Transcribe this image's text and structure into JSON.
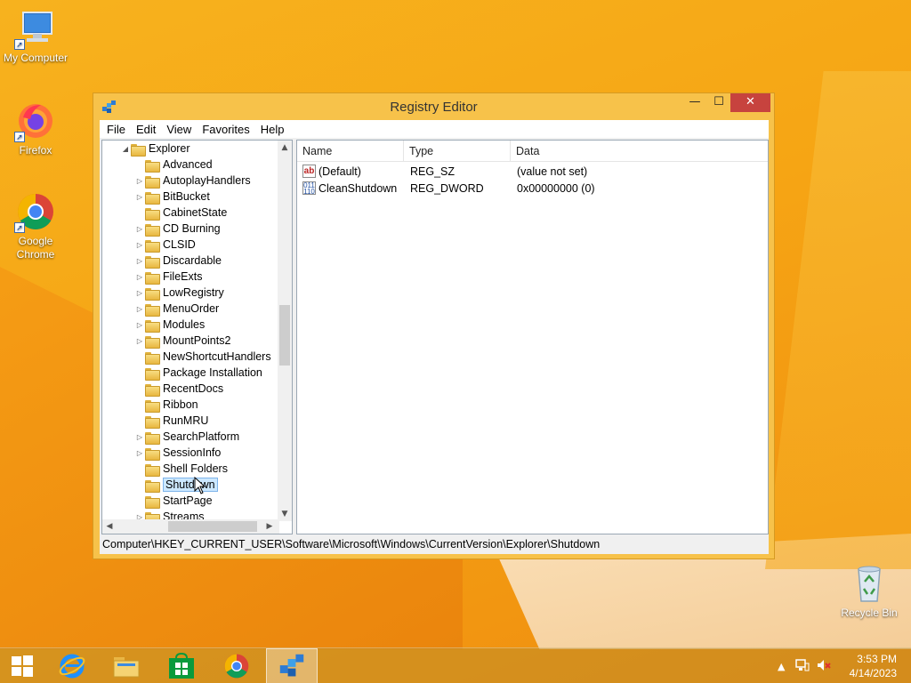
{
  "desktop": {
    "icons": [
      {
        "label": "My Computer"
      },
      {
        "label": "Firefox"
      },
      {
        "label": "Google Chrome"
      },
      {
        "label": "Recycle Bin"
      }
    ]
  },
  "window": {
    "title": "Registry Editor",
    "menu": [
      "File",
      "Edit",
      "View",
      "Favorites",
      "Help"
    ],
    "tree": {
      "parent": "Explorer",
      "items": [
        {
          "label": "Advanced",
          "expandable": false
        },
        {
          "label": "AutoplayHandlers",
          "expandable": true
        },
        {
          "label": "BitBucket",
          "expandable": true
        },
        {
          "label": "CabinetState",
          "expandable": false
        },
        {
          "label": "CD Burning",
          "expandable": true
        },
        {
          "label": "CLSID",
          "expandable": true
        },
        {
          "label": "Discardable",
          "expandable": true
        },
        {
          "label": "FileExts",
          "expandable": true
        },
        {
          "label": "LowRegistry",
          "expandable": true
        },
        {
          "label": "MenuOrder",
          "expandable": true
        },
        {
          "label": "Modules",
          "expandable": true
        },
        {
          "label": "MountPoints2",
          "expandable": true
        },
        {
          "label": "NewShortcutHandlers",
          "expandable": false
        },
        {
          "label": "Package Installation",
          "expandable": false
        },
        {
          "label": "RecentDocs",
          "expandable": false
        },
        {
          "label": "Ribbon",
          "expandable": false
        },
        {
          "label": "RunMRU",
          "expandable": false
        },
        {
          "label": "SearchPlatform",
          "expandable": true
        },
        {
          "label": "SessionInfo",
          "expandable": true
        },
        {
          "label": "Shell Folders",
          "expandable": false
        },
        {
          "label": "Shutdown",
          "expandable": false,
          "selected": true
        },
        {
          "label": "StartPage",
          "expandable": false
        },
        {
          "label": "Streams",
          "expandable": true
        }
      ]
    },
    "columns": [
      "Name",
      "Type",
      "Data"
    ],
    "values": [
      {
        "icon": "string-value-icon",
        "name": "(Default)",
        "type": "REG_SZ",
        "data": "(value not set)"
      },
      {
        "icon": "binary-value-icon",
        "name": "CleanShutdown",
        "type": "REG_DWORD",
        "data": "0x00000000 (0)"
      }
    ],
    "status_path": "Computer\\HKEY_CURRENT_USER\\Software\\Microsoft\\Windows\\CurrentVersion\\Explorer\\Shutdown"
  },
  "taskbar": {
    "apps": [
      "start-icon",
      "internet-explorer-icon",
      "file-explorer-icon",
      "store-icon",
      "chrome-icon",
      "regedit-icon"
    ],
    "active_app": "regedit-icon",
    "time": "3:53 PM",
    "date": "4/14/2023"
  },
  "colors": {
    "accent": "#f7c24a",
    "close_button": "#c7433e",
    "selection": "#cce8ff"
  }
}
